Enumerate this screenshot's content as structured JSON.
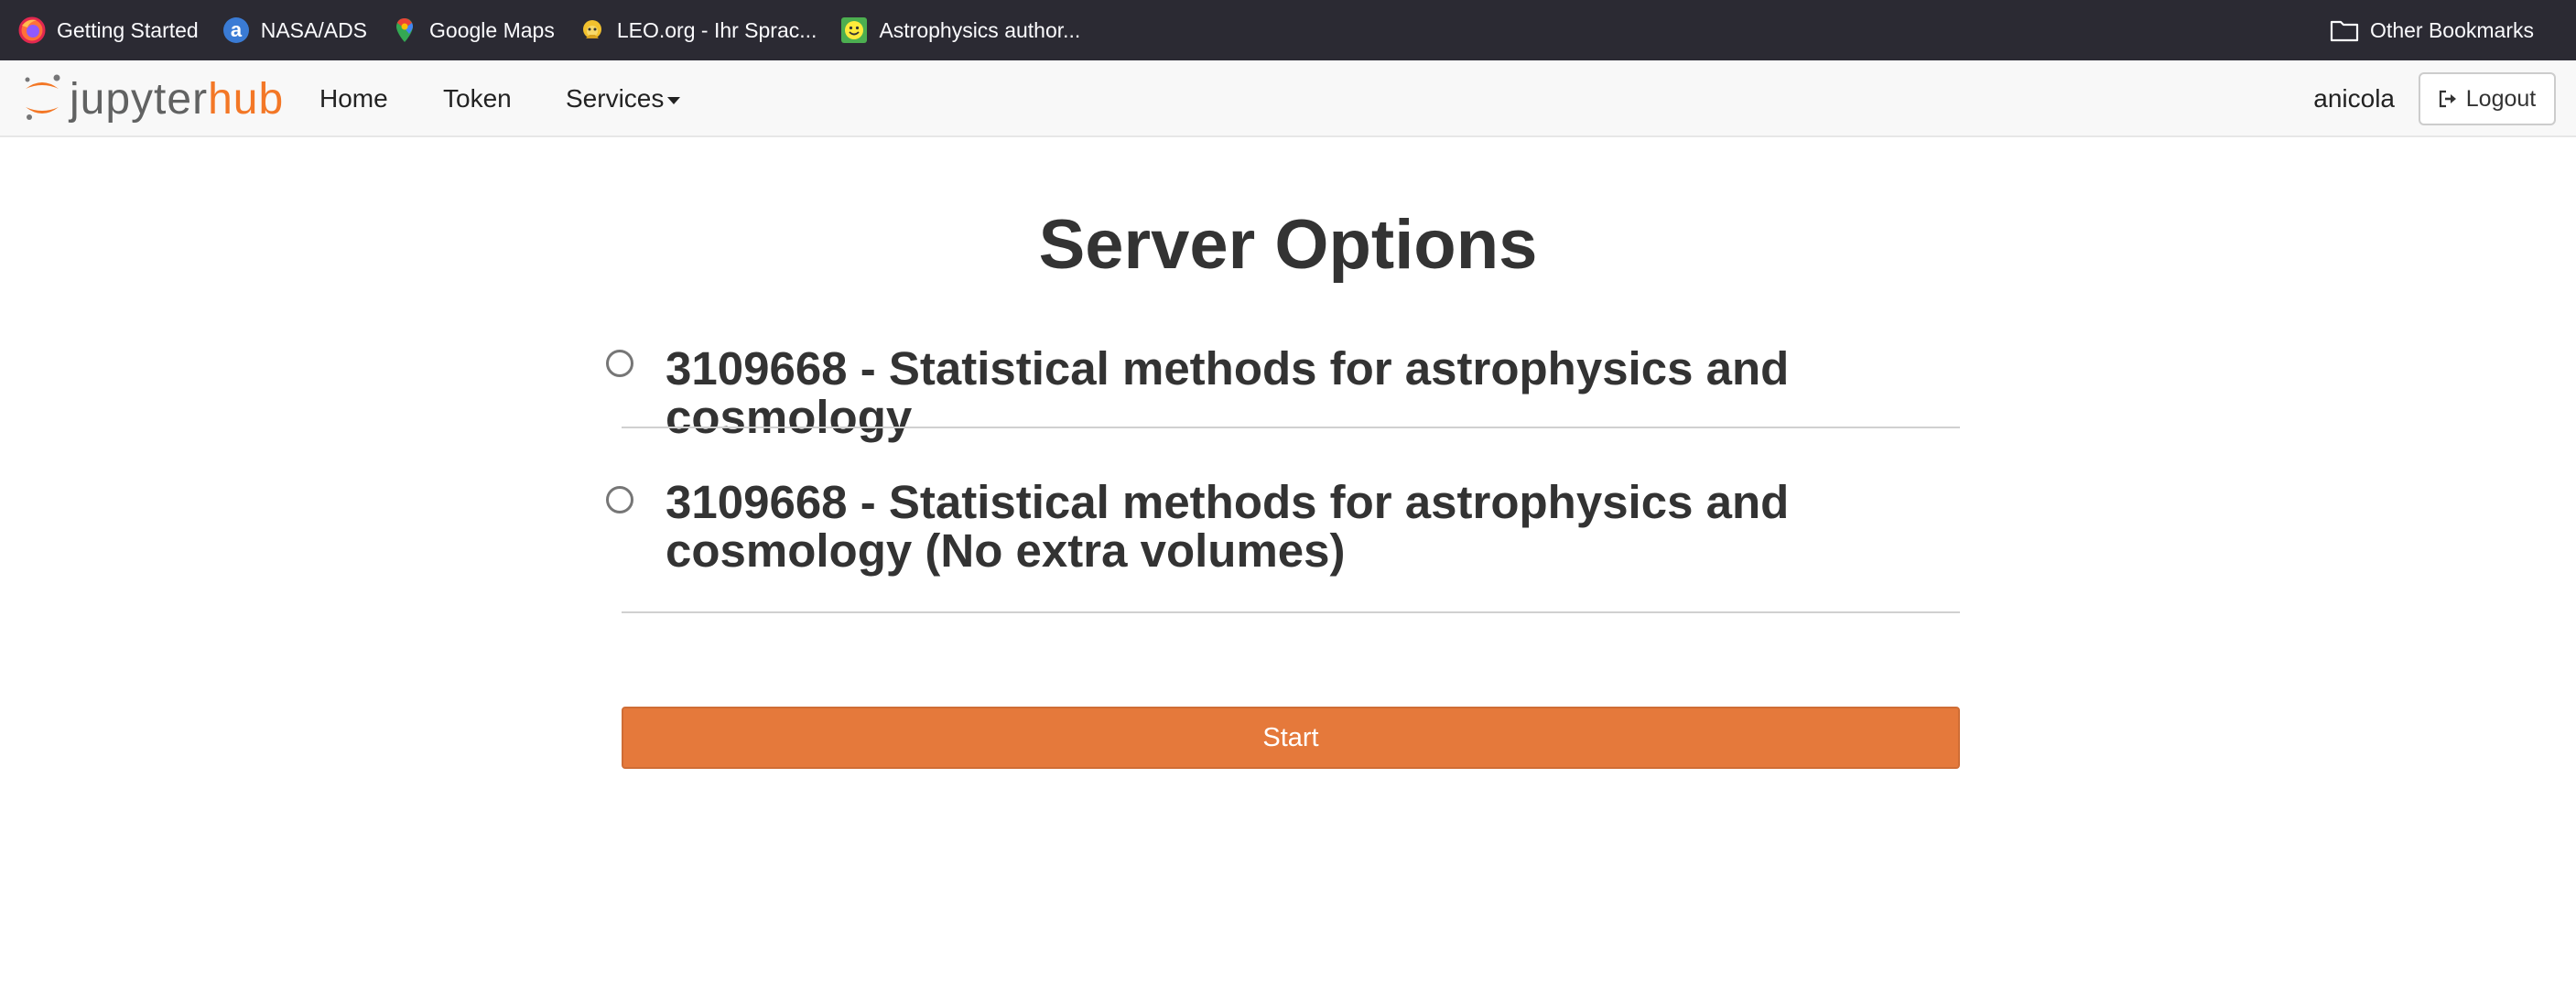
{
  "bookmarks": {
    "items": [
      {
        "label": "Getting Started",
        "icon": "firefox-icon"
      },
      {
        "label": "NASA/ADS",
        "icon": "nasa-ads-icon"
      },
      {
        "label": "Google Maps",
        "icon": "google-maps-icon"
      },
      {
        "label": "LEO.org - Ihr Sprac...",
        "icon": "leo-icon"
      },
      {
        "label": "Astrophysics author...",
        "icon": "smiley-icon"
      }
    ],
    "other": {
      "label": "Other Bookmarks",
      "icon": "folder-icon"
    }
  },
  "navbar": {
    "logo": {
      "jupyter": "jupyter",
      "hub": "hub"
    },
    "links": {
      "home": "Home",
      "token": "Token",
      "services": "Services"
    },
    "username": "anicola",
    "logout_label": "Logout"
  },
  "main": {
    "title": "Server Options",
    "options": [
      {
        "label": "3109668 - Statistical methods for astrophysics and cosmology",
        "selected": false
      },
      {
        "label": "3109668 - Statistical methods for astrophysics and cosmology (No extra volumes)",
        "selected": false
      }
    ],
    "start_label": "Start"
  },
  "colors": {
    "bookmarks_bg": "#2b2a33",
    "navbar_bg": "#f8f8f8",
    "accent_orange": "#e5793b",
    "logo_orange": "#f37726"
  }
}
